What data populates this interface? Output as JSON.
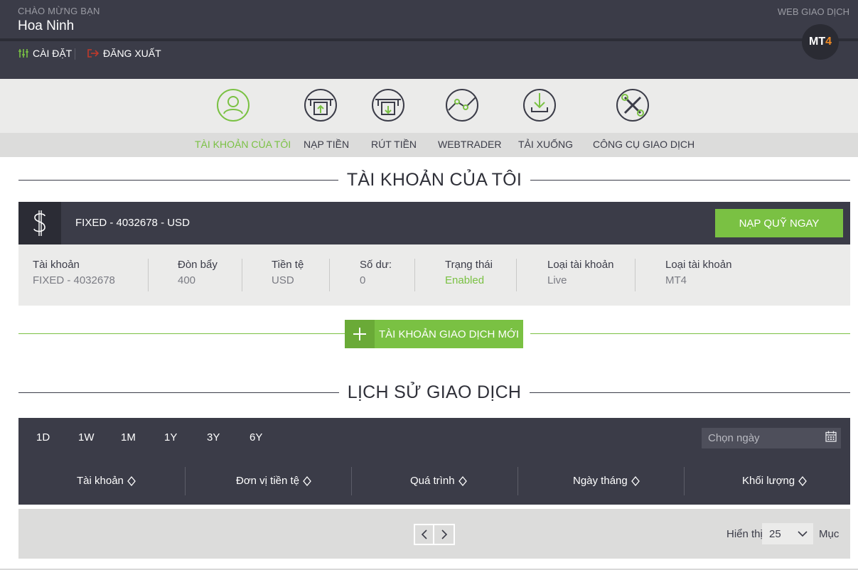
{
  "header": {
    "greeting": "CHÀO MỪNG BẠN",
    "user_name": "Hoa Ninh",
    "settings_label": "CÀI ĐẶT",
    "logout_label": "ĐĂNG XUẤT",
    "web_label": "WEB GIAO DỊCH",
    "platform_badge_main": "MT",
    "platform_badge_num": "4"
  },
  "nav": {
    "items": [
      {
        "label": "TÀI KHOẢN CỦA TÔI",
        "icon": "user-icon",
        "active": true
      },
      {
        "label": "NẠP TIỀN",
        "icon": "deposit-icon",
        "active": false
      },
      {
        "label": "RÚT TIỀN",
        "icon": "withdraw-icon",
        "active": false
      },
      {
        "label": "WEBTRADER",
        "icon": "chart-line-icon",
        "active": false
      },
      {
        "label": "TẢI XUỐNG",
        "icon": "download-icon",
        "active": false
      },
      {
        "label": "CÔNG CỤ GIAO DỊCH",
        "icon": "tools-icon",
        "active": false
      }
    ]
  },
  "account_section": {
    "title": "TÀI KHOẢN CỦA TÔI",
    "account_name": "FIXED - 4032678 - USD",
    "fund_button": "NẠP QUỸ NGAY",
    "info": [
      {
        "label": "Tài khoản",
        "value": "FIXED - 4032678"
      },
      {
        "label": "Đòn bẩy",
        "value": "400"
      },
      {
        "label": "Tiền tệ",
        "value": "USD"
      },
      {
        "label": "Số dư:",
        "value": "0"
      },
      {
        "label": "Trạng thái",
        "value": "Enabled"
      },
      {
        "label": "Loại tài khoản",
        "value": "Live"
      },
      {
        "label": "Loại tài khoản",
        "value": "MT4"
      }
    ],
    "new_account_button": "TÀI KHOẢN GIAO DỊCH MỚI",
    "status_color": "#7ac143"
  },
  "history_section": {
    "title": "LỊCH SỬ GIAO DỊCH",
    "periods": [
      "1D",
      "1W",
      "1M",
      "1Y",
      "3Y",
      "6Y"
    ],
    "date_placeholder": "Chọn ngày",
    "columns": [
      "Tài khoản",
      "Đơn vị tiền tệ",
      "Quá trình",
      "Ngày tháng",
      "Khối lượng"
    ],
    "show_label": "Hiển thị",
    "page_size": "25",
    "items_label": "Mục"
  },
  "colors": {
    "dark": "#3b3c48",
    "accent": "#7ac143",
    "light": "#ebebea"
  }
}
